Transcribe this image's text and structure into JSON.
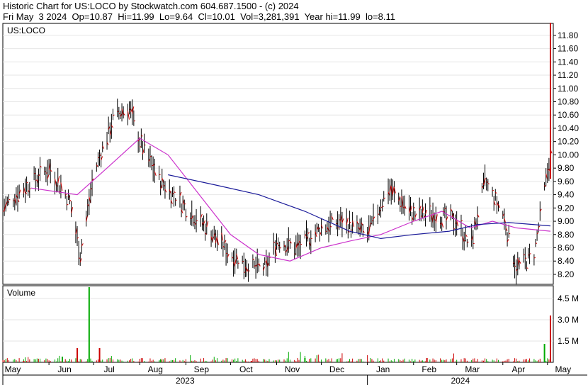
{
  "header": {
    "line1": "Historic Chart for US:LOCO by Stockwatch.com 604.687.1500 - (c) 2024",
    "line2": "Fri May  3 2024  Op=10.87  Hi=11.99  Lo=9.64  Cl=10.01  Vol=3,281,391  Year hi=11.99  lo=8.11"
  },
  "colors": {
    "price_bar": "#000000",
    "up_tick": "#cc0000",
    "ma_short": "#cc33cc",
    "ma_long": "#1a1a99",
    "volume_bar_up": "#00aa00",
    "volume_bar_down": "#cc0000",
    "grid": "#e6e6e6"
  },
  "chart_data": [
    {
      "type": "line",
      "chart": "price",
      "symbol_label": "US:LOCO",
      "ylim": [
        8.05,
        11.98
      ],
      "y_ticks": [
        "11.80",
        "11.60",
        "11.40",
        "11.20",
        "11.00",
        "10.80",
        "10.60",
        "10.40",
        "10.20",
        "10.00",
        "9.80",
        "9.60",
        "9.40",
        "9.20",
        "9.00",
        "8.80",
        "8.60",
        "8.40",
        "8.20"
      ],
      "x_months": [
        "May",
        "Jun",
        "Jul",
        "Aug",
        "Sep",
        "Oct",
        "Nov",
        "Dec",
        "Jan",
        "Feb",
        "Mar",
        "Apr",
        "May"
      ],
      "x_years": [
        "2023",
        "2024"
      ],
      "grid": true,
      "series": [
        {
          "role": "close",
          "x": [
            "2023-05-01",
            "2023-05-15",
            "2023-06-01",
            "2023-06-15",
            "2023-06-22",
            "2023-07-01",
            "2023-07-15",
            "2023-07-25",
            "2023-08-01",
            "2023-08-15",
            "2023-09-01",
            "2023-09-15",
            "2023-10-01",
            "2023-10-15",
            "2023-10-25",
            "2023-11-01",
            "2023-11-15",
            "2023-12-01",
            "2023-12-15",
            "2024-01-01",
            "2024-01-15",
            "2024-02-01",
            "2024-02-15",
            "2024-03-01",
            "2024-03-10",
            "2024-03-20",
            "2024-04-01",
            "2024-04-10",
            "2024-04-22",
            "2024-05-03"
          ],
          "values": [
            9.2,
            9.5,
            9.8,
            9.3,
            8.5,
            9.7,
            10.6,
            10.7,
            10.2,
            9.6,
            9.2,
            8.9,
            8.5,
            8.3,
            8.3,
            8.7,
            8.6,
            8.9,
            9.0,
            8.8,
            9.5,
            9.1,
            9.1,
            9.0,
            8.6,
            9.6,
            9.1,
            8.3,
            8.5,
            10.01
          ]
        },
        {
          "role": "moving_average_short",
          "x": [
            "2023-05-20",
            "2023-06-20",
            "2023-07-10",
            "2023-08-01",
            "2023-08-20",
            "2023-09-10",
            "2023-10-01",
            "2023-10-20",
            "2023-11-10",
            "2023-12-01",
            "2023-12-20",
            "2024-01-10",
            "2024-02-01",
            "2024-02-20",
            "2024-03-10",
            "2024-03-25",
            "2024-04-10",
            "2024-05-03"
          ],
          "values": [
            9.5,
            9.4,
            9.8,
            10.25,
            10.0,
            9.4,
            8.8,
            8.5,
            8.4,
            8.6,
            8.7,
            8.8,
            9.0,
            9.15,
            8.9,
            9.0,
            8.9,
            8.85
          ]
        },
        {
          "role": "moving_average_long",
          "x": [
            "2023-08-20",
            "2023-09-20",
            "2023-10-20",
            "2023-11-20",
            "2023-12-20",
            "2024-01-10",
            "2024-02-01",
            "2024-02-25",
            "2024-03-15",
            "2024-04-05",
            "2024-05-03"
          ],
          "values": [
            9.7,
            9.55,
            9.4,
            9.15,
            8.85,
            8.74,
            8.8,
            8.85,
            8.95,
            8.98,
            8.93
          ]
        }
      ]
    },
    {
      "type": "bar",
      "chart": "volume",
      "title": "Volume",
      "ylim": [
        0,
        5.4
      ],
      "y_ticks": [
        "4.5 M",
        "3.0 M",
        "1.5 M"
      ],
      "x": [
        "2023-05-15",
        "2023-06-10",
        "2023-06-20",
        "2023-06-28",
        "2023-07-05",
        "2023-08-15",
        "2023-10-15",
        "2023-11-20",
        "2024-02-10",
        "2024-04-29",
        "2024-05-03"
      ],
      "values": [
        0.1,
        0.4,
        1.0,
        5.3,
        1.0,
        0.15,
        0.1,
        0.3,
        0.3,
        1.3,
        3.3
      ]
    }
  ]
}
